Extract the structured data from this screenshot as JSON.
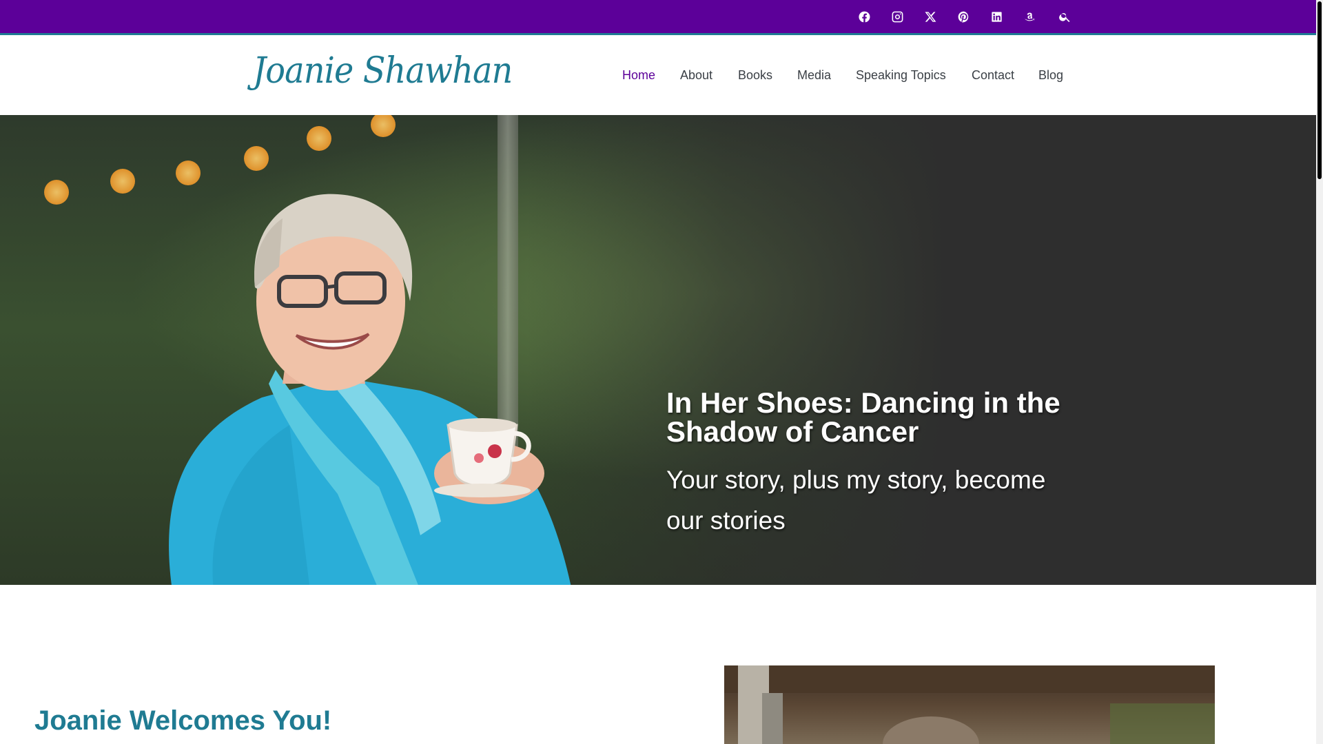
{
  "colors": {
    "topbar": "#5c0099",
    "accent": "#1f7b92",
    "nav_text": "#3a3f45",
    "nav_active": "#5c0099",
    "hero_dark": "#2e2e2e"
  },
  "social_icons": [
    "facebook-icon",
    "instagram-icon",
    "x-twitter-icon",
    "pinterest-icon",
    "linkedin-icon",
    "amazon-icon",
    "search-icon"
  ],
  "header": {
    "logo": "Joanie Shawhan",
    "nav": [
      {
        "label": "Home",
        "active": true
      },
      {
        "label": "About",
        "active": false
      },
      {
        "label": "Books",
        "active": false
      },
      {
        "label": "Media",
        "active": false
      },
      {
        "label": "Speaking Topics",
        "active": false
      },
      {
        "label": "Contact",
        "active": false
      },
      {
        "label": "Blog",
        "active": false
      }
    ]
  },
  "hero": {
    "title": "In Her Shoes: Dancing in the Shadow of Cancer",
    "subtitle": "Your story, plus my story, become our stories"
  },
  "welcome": {
    "heading": "Joanie Welcomes You!"
  }
}
